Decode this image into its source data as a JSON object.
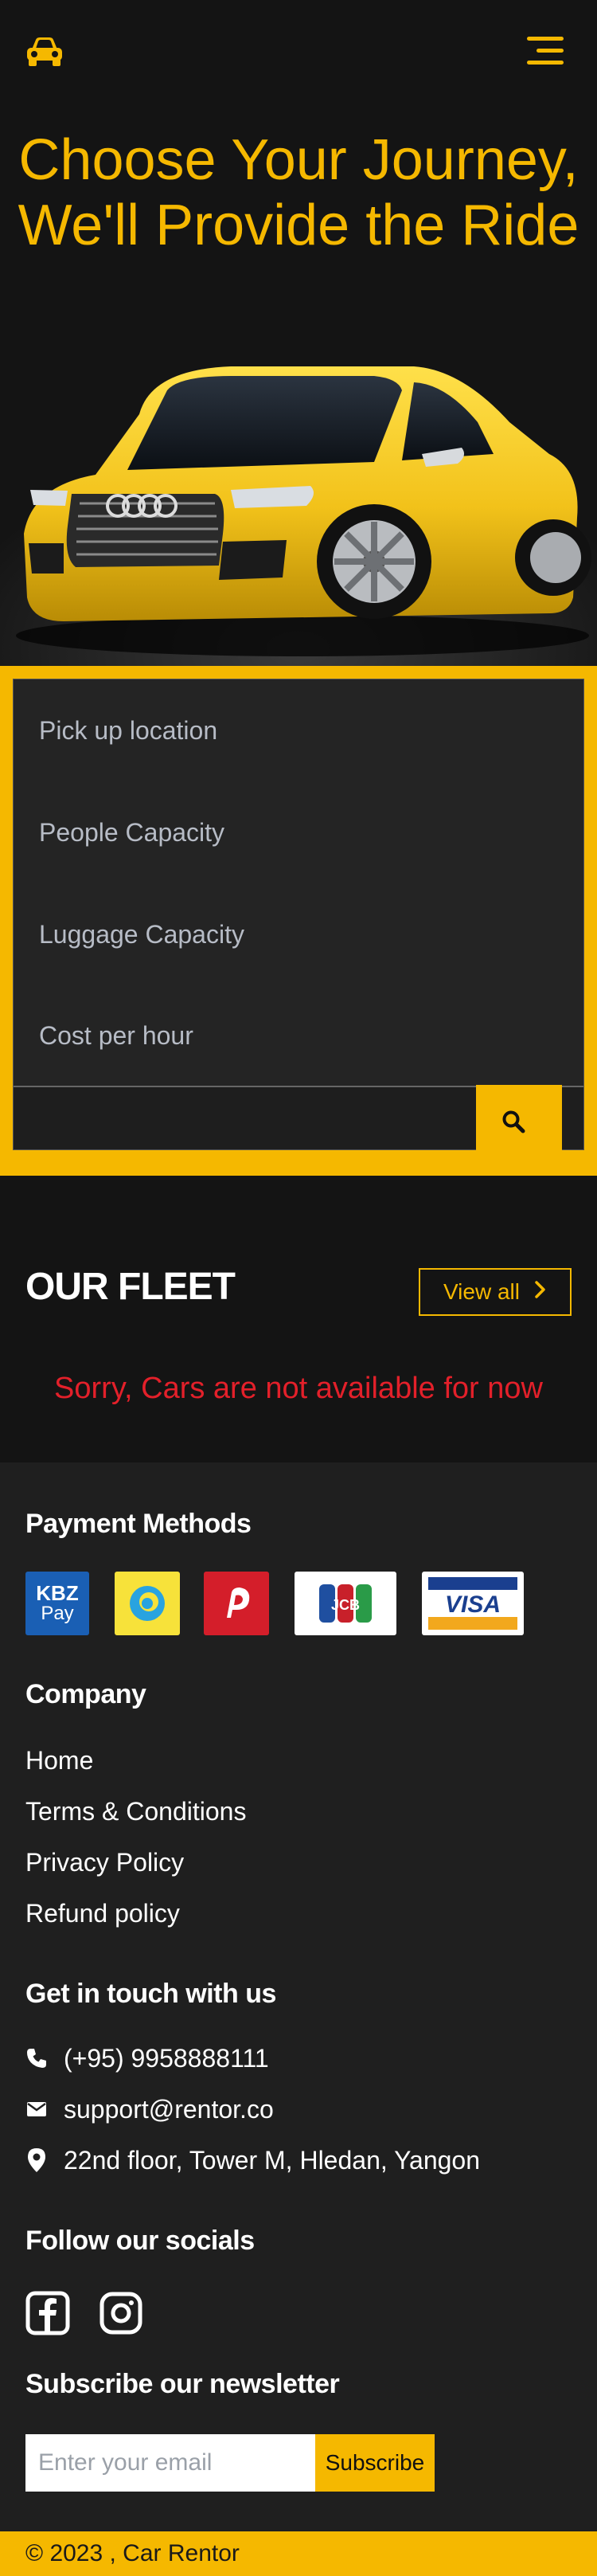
{
  "nav": {
    "logo_icon": "car-icon",
    "menu_icon": "hamburger-menu-icon"
  },
  "hero": {
    "title_line1": "Choose Your Journey,",
    "title_line2": "We'll Provide the Ride"
  },
  "search": {
    "fields": [
      "Pick up location",
      "People Capacity",
      "Luggage Capacity",
      "Cost per hour"
    ],
    "button_icon": "search-icon"
  },
  "fleet": {
    "title": "OUR FLEET",
    "view_all": "View all",
    "empty_message": "Sorry, Cars are not available for now"
  },
  "footer": {
    "payment_heading": "Payment Methods",
    "payment_logos": [
      "kbzpay-logo",
      "wavepay-logo",
      "pay-logo",
      "jcb-logo",
      "visa-logo"
    ],
    "kbz_line1": "KBZ",
    "kbz_line2": "Pay",
    "jcb_text": "JCB",
    "visa_text": "VISA",
    "company_heading": "Company",
    "company_links": [
      "Home",
      "Terms & Conditions",
      "Privacy Policy",
      "Refund policy"
    ],
    "contact_heading": "Get in touch with us",
    "phone": "(+95) 9958888111",
    "email": "support@rentor.co",
    "address": "22nd floor, Tower M, Hledan, Yangon",
    "socials_heading": "Follow our socials",
    "newsletter_heading": "Subscribe our newsletter",
    "newsletter_placeholder": "Enter your email",
    "subscribe_label": "Subscribe",
    "copyright": "© 2023 , Car Rentor"
  },
  "colors": {
    "accent": "#f5b800",
    "background": "#1f1f1f",
    "hero_background": "#141414",
    "error": "#e3202a"
  }
}
